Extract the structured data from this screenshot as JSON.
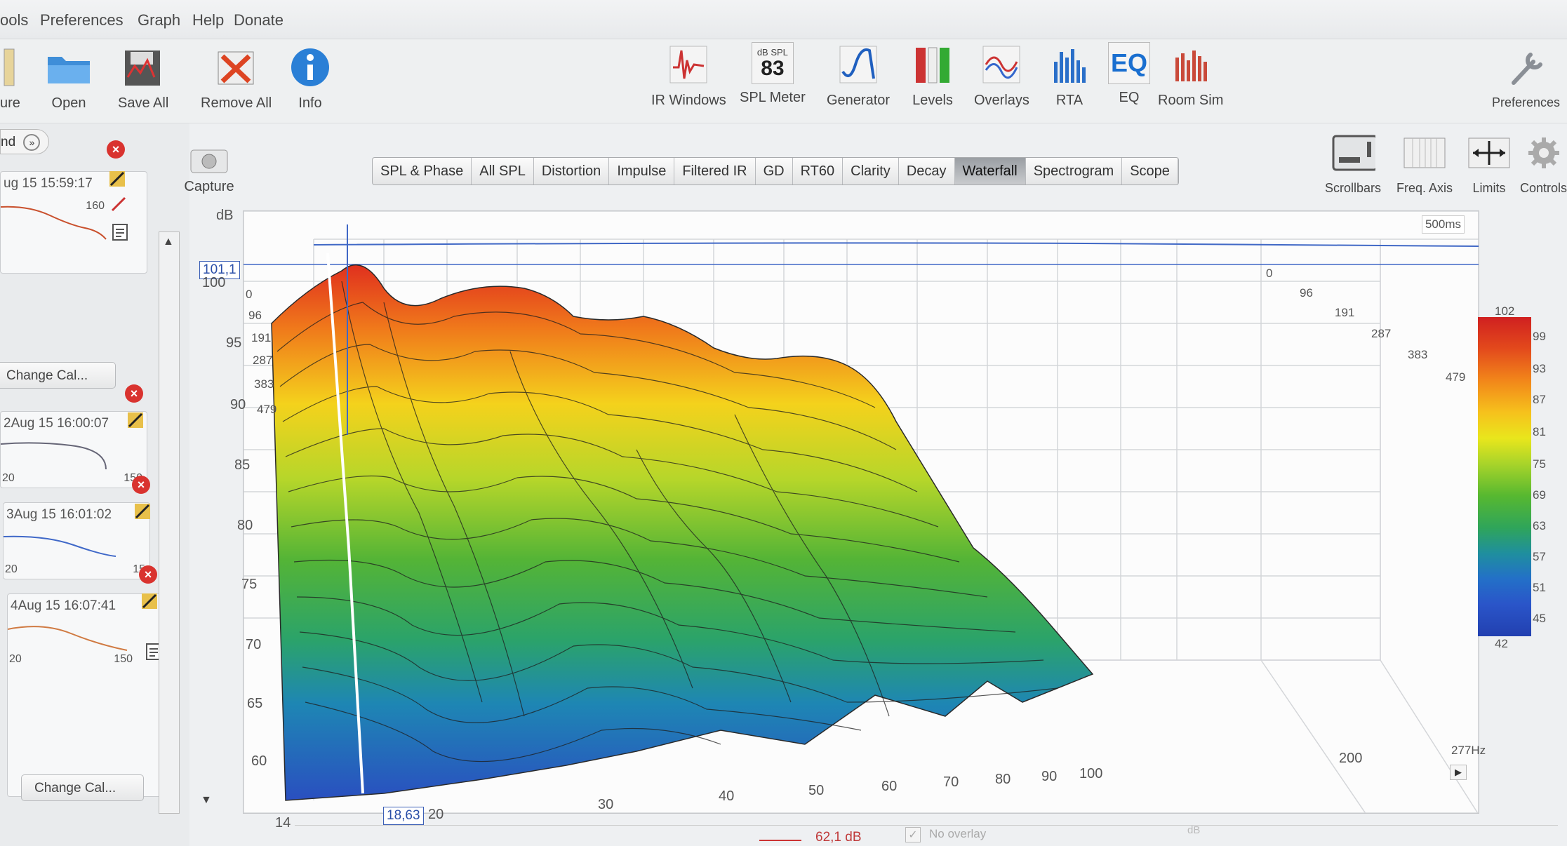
{
  "menu": [
    "ools",
    "Preferences",
    "Graph",
    "Help",
    "Donate"
  ],
  "toolbar_left": {
    "partial_label": "ure",
    "items": [
      {
        "label": "Open",
        "icon": "folder-icon"
      },
      {
        "label": "Save All",
        "icon": "floppy-icon"
      },
      {
        "label": "Remove All",
        "icon": "remove-all-icon"
      },
      {
        "label": "Info",
        "icon": "info-icon"
      }
    ]
  },
  "toolbar_center": [
    {
      "label": "IR Windows",
      "icon": "ir-windows-icon"
    },
    {
      "label": "SPL Meter",
      "icon": "spl-meter-icon",
      "badge_top": "dB SPL",
      "badge_value": "83"
    },
    {
      "label": "Generator",
      "icon": "generator-icon"
    },
    {
      "label": "Levels",
      "icon": "levels-icon"
    },
    {
      "label": "Overlays",
      "icon": "overlays-icon"
    },
    {
      "label": "RTA",
      "icon": "rta-icon"
    },
    {
      "label": "EQ",
      "icon": "eq-icon"
    },
    {
      "label": "Room Sim",
      "icon": "room-sim-icon"
    }
  ],
  "toolbar_right": {
    "label": "Preferences",
    "icon": "wrench-icon"
  },
  "graph_controls": [
    {
      "label": "Scrollbars",
      "icon": "scrollbars-icon"
    },
    {
      "label": "Freq. Axis",
      "icon": "freq-axis-icon"
    },
    {
      "label": "Limits",
      "icon": "limits-icon"
    },
    {
      "label": "Controls",
      "icon": "controls-gear-icon"
    }
  ],
  "capture": {
    "label": "Capture",
    "unit": "dB"
  },
  "left_panel": {
    "nav_partial": "nd",
    "measurements": [
      {
        "timestamp": "ug 15 15:59:17",
        "ax_left": "",
        "ax_right": "160"
      },
      {
        "timestamp": "2Aug 15 16:00:07",
        "ax_left": "20",
        "ax_right": "150"
      },
      {
        "timestamp": "3Aug 15 16:01:02",
        "ax_left": "20",
        "ax_right": "15"
      },
      {
        "timestamp": "4Aug 15 16:07:41",
        "ax_left": "20",
        "ax_right": "150"
      }
    ],
    "change_cal_label": "Change Cal..."
  },
  "tabs": [
    {
      "label": "SPL & Phase",
      "active": false
    },
    {
      "label": "All SPL",
      "active": false
    },
    {
      "label": "Distortion",
      "active": false
    },
    {
      "label": "Impulse",
      "active": false
    },
    {
      "label": "Filtered IR",
      "active": false
    },
    {
      "label": "GD",
      "active": false
    },
    {
      "label": "RT60",
      "active": false
    },
    {
      "label": "Clarity",
      "active": false
    },
    {
      "label": "Decay",
      "active": false
    },
    {
      "label": "Waterfall",
      "active": true
    },
    {
      "label": "Spectrogram",
      "active": false
    },
    {
      "label": "Scope",
      "active": false
    }
  ],
  "waterfall": {
    "time_window_label": "500ms",
    "cursor_db": "101,1",
    "cursor_freq": "18,63",
    "y_ticks": [
      "100",
      "95",
      "90",
      "85",
      "80",
      "75",
      "70",
      "65",
      "60"
    ],
    "x_ticks": [
      "14",
      "20",
      "30",
      "40",
      "50",
      "60",
      "70",
      "80",
      "90",
      "100",
      "200",
      "277Hz"
    ],
    "depth_ticks": [
      "0",
      "96",
      "191",
      "287",
      "383",
      "479"
    ],
    "colorbar_ticks": [
      "102",
      "99",
      "93",
      "87",
      "81",
      "75",
      "69",
      "63",
      "57",
      "51",
      "45",
      "42"
    ]
  },
  "status_bar": {
    "readout": "62,1 dB",
    "overlay": "No overlay",
    "db_hint": "dB"
  }
}
